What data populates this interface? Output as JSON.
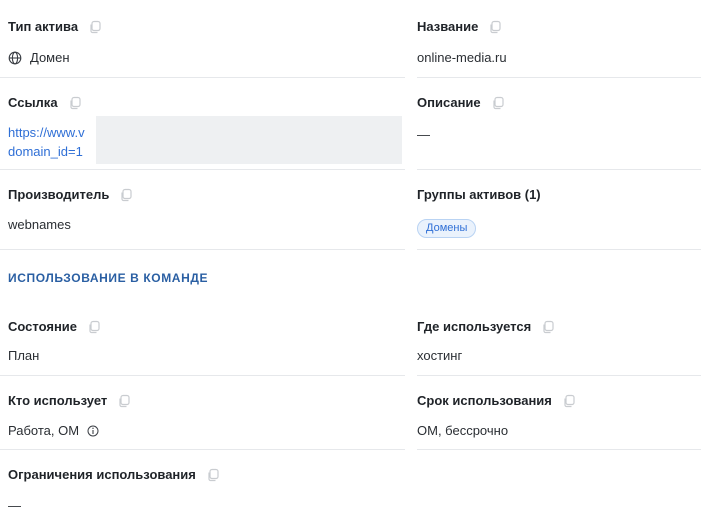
{
  "fields": {
    "asset_type": {
      "label": "Тип актива",
      "value": "Домен",
      "icon": "globe-icon"
    },
    "name": {
      "label": "Название",
      "value": "online-media.ru"
    },
    "link": {
      "label": "Ссылка",
      "line1": "https://www.v",
      "line2": "domain_id=1"
    },
    "description": {
      "label": "Описание",
      "value": "—"
    },
    "manufacturer": {
      "label": "Производитель",
      "value": "webnames"
    },
    "asset_groups": {
      "label": "Группы активов (1)",
      "badge": "Домены"
    }
  },
  "section_title": "ИСПОЛЬЗОВАНИЕ В КОМАНДЕ",
  "usage": {
    "state": {
      "label": "Состояние",
      "value": "План"
    },
    "where_used": {
      "label": "Где используется",
      "value": "хостинг"
    },
    "who_uses": {
      "label": "Кто использует",
      "value": "Работа, ОМ",
      "icon": "info-icon"
    },
    "usage_term": {
      "label": "Срок использования",
      "value": "ОМ, бессрочно"
    },
    "restrictions": {
      "label": "Ограничения использования",
      "value": "—"
    }
  },
  "colors": {
    "link": "#2f6fd6",
    "section": "#2a5fa3",
    "badge_bg": "#eaf2fc"
  }
}
